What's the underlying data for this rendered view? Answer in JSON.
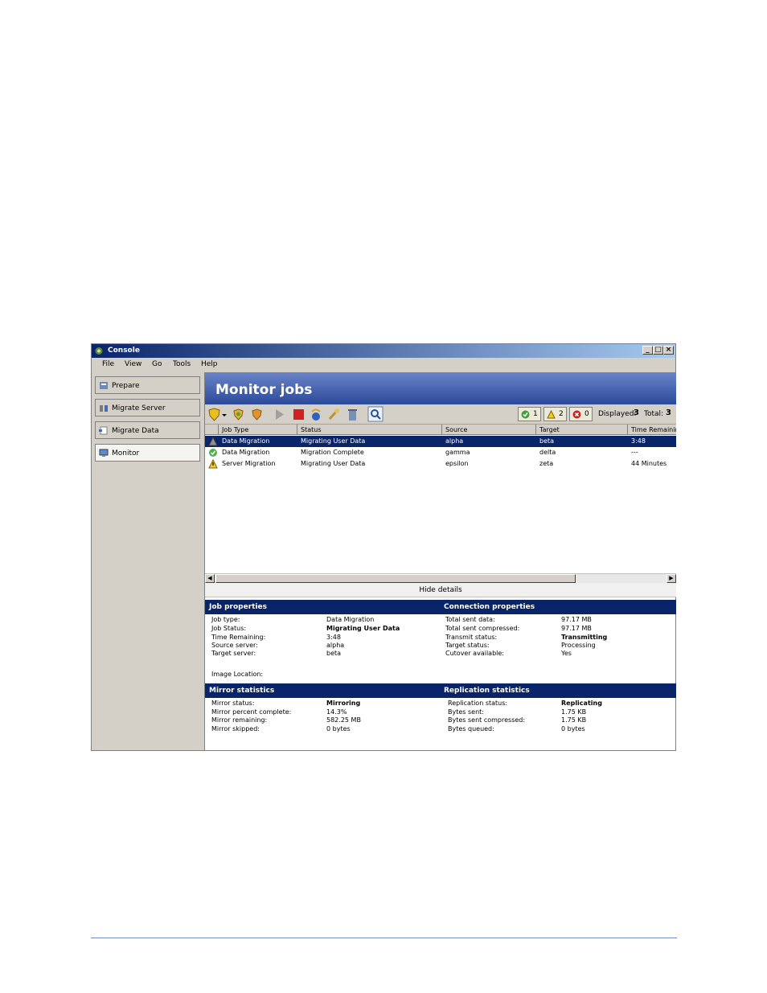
{
  "window": {
    "title": "Console"
  },
  "menu": [
    "File",
    "View",
    "Go",
    "Tools",
    "Help"
  ],
  "nav": [
    {
      "label": "Prepare",
      "active": false
    },
    {
      "label": "Migrate Server",
      "active": false
    },
    {
      "label": "Migrate Data",
      "active": false
    },
    {
      "label": "Monitor",
      "active": true
    }
  ],
  "banner_title": "Monitor jobs",
  "counters": {
    "ok": "1",
    "warning": "2",
    "error": "0"
  },
  "displayed": {
    "label": "Displayed:",
    "value": "3"
  },
  "total": {
    "label": "Total:",
    "value": "3"
  },
  "columns": [
    "Job Type",
    "Status",
    "Source",
    "Target",
    "Time Remainin"
  ],
  "jobs": [
    {
      "icon": "running-job-icon",
      "type": "Data Migration",
      "status": "Migrating User Data",
      "source": "alpha",
      "target": "beta",
      "time": "3:48",
      "selected": true
    },
    {
      "icon": "ok-job-icon",
      "type": "Data Migration",
      "status": "Migration Complete",
      "source": "gamma",
      "target": "delta",
      "time": "---",
      "selected": false
    },
    {
      "icon": "warning-job-icon",
      "type": "Server Migration",
      "status": "Migrating User Data",
      "source": "epsilon",
      "target": "zeta",
      "time": "44 Minutes",
      "selected": false
    }
  ],
  "hide_details": "Hide details",
  "job_properties": {
    "header": "Job properties",
    "rows": [
      {
        "label": "Job type:",
        "value": "Data Migration",
        "bold": false
      },
      {
        "label": "Job Status:",
        "value": "Migrating User Data",
        "bold": true
      },
      {
        "label": "Time Remaining:",
        "value": "3:48",
        "bold": false
      },
      {
        "label": "Source server:",
        "value": "alpha",
        "bold": false
      },
      {
        "label": "Target server:",
        "value": "beta",
        "bold": false
      }
    ],
    "image_location": "Image Location:"
  },
  "connection_properties": {
    "header": "Connection properties",
    "rows": [
      {
        "label": "Total sent data:",
        "value": "97.17 MB",
        "bold": false
      },
      {
        "label": "Total sent compressed:",
        "value": "97.17 MB",
        "bold": false
      },
      {
        "label": "Transmit status:",
        "value": "Transmitting",
        "bold": true
      },
      {
        "label": "Target status:",
        "value": "Processing",
        "bold": false
      },
      {
        "label": "Cutover available:",
        "value": "Yes",
        "bold": false
      }
    ]
  },
  "mirror_statistics": {
    "header": "Mirror statistics",
    "rows": [
      {
        "label": "Mirror status:",
        "value": "Mirroring",
        "bold": true
      },
      {
        "label": "Mirror percent complete:",
        "value": "14.3%",
        "bold": false
      },
      {
        "label": "Mirror remaining:",
        "value": "582.25 MB",
        "bold": false
      },
      {
        "label": "Mirror skipped:",
        "value": "0 bytes",
        "bold": false
      }
    ]
  },
  "replication_statistics": {
    "header": "Replication statistics",
    "rows": [
      {
        "label": "Replication status:",
        "value": "Replicating",
        "bold": true
      },
      {
        "label": "Bytes sent:",
        "value": "1.75 KB",
        "bold": false
      },
      {
        "label": "Bytes sent compressed:",
        "value": "1.75 KB",
        "bold": false
      },
      {
        "label": "Bytes queued:",
        "value": "0 bytes",
        "bold": false
      }
    ]
  },
  "colors": {
    "selection": "#0a246a",
    "section_header": "#0a246a",
    "banner": "#2c4a9a",
    "chrome": "#d4d0c8"
  }
}
